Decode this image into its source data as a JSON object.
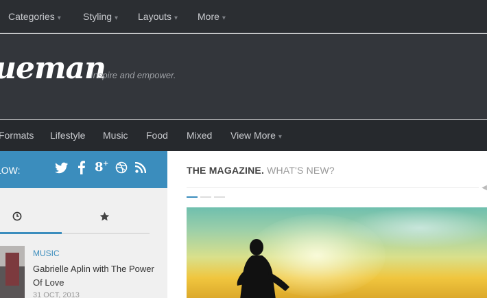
{
  "topnav": {
    "items": [
      {
        "label": "Categories",
        "caret": "▾"
      },
      {
        "label": "Styling",
        "caret": "▾"
      },
      {
        "label": "Layouts",
        "caret": "▾"
      },
      {
        "label": "More",
        "caret": "▾"
      }
    ]
  },
  "header": {
    "logo": "ueman",
    "tagline": "Inspire and empower."
  },
  "subnav": {
    "items": [
      {
        "label": "Formats"
      },
      {
        "label": "Lifestyle"
      },
      {
        "label": "Music"
      },
      {
        "label": "Food"
      },
      {
        "label": "Mixed"
      },
      {
        "label": "View More",
        "caret": "▾"
      }
    ]
  },
  "sidebar": {
    "follow_label": "LOW:",
    "social_icons": [
      "twitter-icon",
      "facebook-icon",
      "google-plus-icon",
      "dribbble-icon",
      "rss-icon"
    ],
    "social_glyphs": {
      "twitter": "🐦",
      "facebook": "f",
      "googleplus": "8⁺",
      "dribbble": "⊛",
      "rss": "⋱"
    },
    "tabs": [
      {
        "icon": "clock-icon",
        "glyph": "⊙",
        "active": true
      },
      {
        "icon": "star-icon",
        "glyph": "★",
        "active": false
      }
    ],
    "post": {
      "category": "MUSIC",
      "title": "Gabrielle Aplin with The Power Of Love",
      "date": "31 OCT, 2013"
    }
  },
  "main": {
    "section_title": "THE MAGAZINE.",
    "section_subtitle": "WHAT'S NEW?",
    "slider": {
      "active_index": 0,
      "count": 3
    }
  },
  "colors": {
    "accent": "#3b8dbd",
    "topnav_bg": "#2b2e32",
    "header_bg": "#33363b",
    "subnav_bg": "#26292d"
  }
}
